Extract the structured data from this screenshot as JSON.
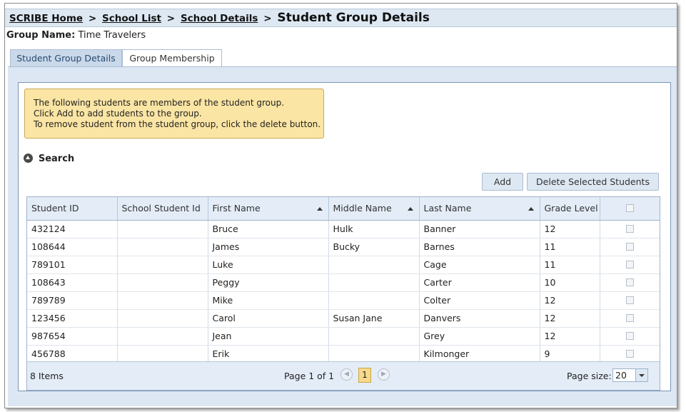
{
  "breadcrumb": {
    "links": [
      "SCRIBE Home",
      "School List",
      "School Details"
    ],
    "separator": ">",
    "current": "Student Group Details"
  },
  "group": {
    "label": "Group Name:",
    "value": "Time Travelers"
  },
  "tabs": [
    {
      "label": "Student Group Details",
      "active": false
    },
    {
      "label": "Group Membership",
      "active": true
    }
  ],
  "info": {
    "lines": [
      "The following students are members of the student group.",
      "Click Add to add students to the group.",
      "To remove student from the student group, click the delete button."
    ]
  },
  "search": {
    "label": "Search",
    "icon": "expand-circle-icon"
  },
  "actions": {
    "add_label": "Add",
    "delete_label": "Delete Selected Students"
  },
  "grid": {
    "columns": [
      "Student ID",
      "School Student Id",
      "First Name",
      "Middle Name",
      "Last Name",
      "Grade Level"
    ],
    "sorted_columns": [
      "First Name",
      "Middle Name",
      "Last Name"
    ],
    "rows": [
      [
        "432124",
        "",
        "Bruce",
        "Hulk",
        "Banner",
        "12"
      ],
      [
        "108644",
        "",
        "James",
        "Bucky",
        "Barnes",
        "11"
      ],
      [
        "789101",
        "",
        "Luke",
        "",
        "Cage",
        "11"
      ],
      [
        "108643",
        "",
        "Peggy",
        "",
        "Carter",
        "10"
      ],
      [
        "789789",
        "",
        "Mike",
        "",
        "Colter",
        "12"
      ],
      [
        "123456",
        "",
        "Carol",
        "Susan Jane",
        "Danvers",
        "12"
      ],
      [
        "987654",
        "",
        "Jean",
        "",
        "Grey",
        "12"
      ],
      [
        "456788",
        "",
        "Erik",
        "",
        "Kilmonger",
        "9"
      ]
    ]
  },
  "pager": {
    "items_text": "8 Items",
    "page_text": "Page 1 of 1",
    "current_page": "1",
    "page_size_label": "Page size:",
    "page_size": "20"
  },
  "colors": {
    "header_bg": "#dde8f3",
    "panel_bg": "#dce7f3",
    "info_bg": "#fbe5a4",
    "page_highlight": "#f6d98a"
  }
}
